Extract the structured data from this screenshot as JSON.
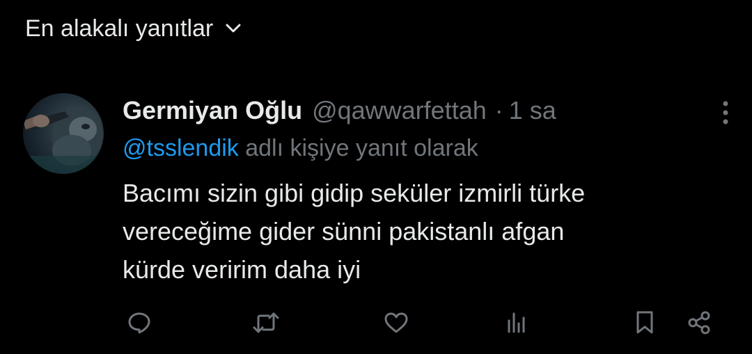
{
  "sort": {
    "label": "En alakalı yanıtlar",
    "icon": "chevron-down-icon"
  },
  "tweet": {
    "display_name": "Germiyan Oğlu",
    "handle": "@qawwarfettah",
    "separator": "·",
    "time": "1 sa",
    "reply_to": {
      "mention": "@tsslendik",
      "suffix": " adlı kişiye yanıt olarak"
    },
    "text_lines": [
      "Bacımı sizin gibi gidip seküler izmirli türke",
      "vereceğime gider sünni pakistanlı afgan",
      "kürde veririm daha iyi"
    ],
    "more_icon": "more-vertical-icon"
  },
  "actions": [
    {
      "name": "reply",
      "icon": "reply-icon"
    },
    {
      "name": "repost",
      "icon": "repost-icon"
    },
    {
      "name": "like",
      "icon": "like-icon"
    },
    {
      "name": "views",
      "icon": "views-icon"
    },
    {
      "name": "bookmark",
      "icon": "bookmark-icon"
    },
    {
      "name": "share",
      "icon": "share-icon"
    }
  ],
  "colors": {
    "background": "#000000",
    "primary_text": "#e7e9ea",
    "secondary_text": "#71767b",
    "link": "#1d9bf0"
  }
}
